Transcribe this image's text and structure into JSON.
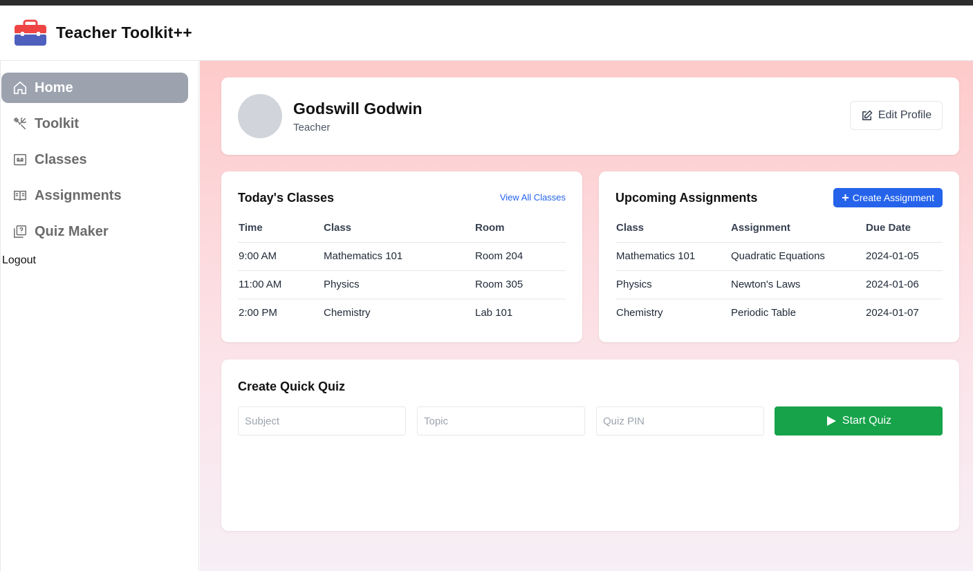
{
  "app": {
    "title": "Teacher Toolkit++"
  },
  "sidebar": {
    "items": [
      {
        "label": "Home",
        "icon": "home-icon",
        "active": true
      },
      {
        "label": "Toolkit",
        "icon": "tools-icon"
      },
      {
        "label": "Classes",
        "icon": "classes-icon"
      },
      {
        "label": "Assignments",
        "icon": "book-icon"
      },
      {
        "label": "Quiz Maker",
        "icon": "quiz-icon"
      }
    ],
    "logout": "Logout"
  },
  "profile": {
    "name": "Godswill Godwin",
    "role": "Teacher",
    "edit_label": "Edit Profile"
  },
  "classes": {
    "title": "Today's Classes",
    "view_all": "View All Classes",
    "headers": [
      "Time",
      "Class",
      "Room"
    ],
    "rows": [
      [
        "9:00 AM",
        "Mathematics 101",
        "Room 204"
      ],
      [
        "11:00 AM",
        "Physics",
        "Room 305"
      ],
      [
        "2:00 PM",
        "Chemistry",
        "Lab 101"
      ]
    ]
  },
  "assignments": {
    "title": "Upcoming Assignments",
    "create_label": "Create Assignment",
    "headers": [
      "Class",
      "Assignment",
      "Due Date"
    ],
    "rows": [
      [
        "Mathematics 101",
        "Quadratic Equations",
        "2024-01-05"
      ],
      [
        "Physics",
        "Newton's Laws",
        "2024-01-06"
      ],
      [
        "Chemistry",
        "Periodic Table",
        "2024-01-07"
      ]
    ]
  },
  "quiz": {
    "title": "Create Quick Quiz",
    "subject_placeholder": "Subject",
    "topic_placeholder": "Topic",
    "pin_placeholder": "Quiz PIN",
    "start_label": "Start Quiz"
  },
  "colors": {
    "primary": "#2563eb",
    "success": "#16a34a",
    "sidebar_active": "#9ca3af",
    "background_top": "#fecaca"
  }
}
